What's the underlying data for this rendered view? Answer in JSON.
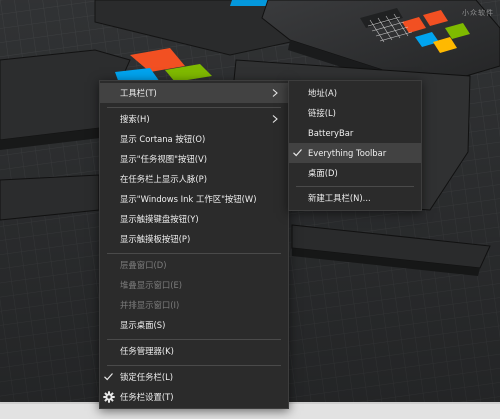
{
  "watermark": "小众软件",
  "main_menu": {
    "toolbars": "工具栏(T)",
    "search": "搜索(H)",
    "show_cortana": "显示 Cortana 按钮(O)",
    "show_task_view": "显示\"任务视图\"按钮(V)",
    "show_people": "在任务栏上显示人脉(P)",
    "show_ink": "显示\"Windows Ink 工作区\"按钮(W)",
    "show_touch_keyboard": "显示触摸键盘按钮(Y)",
    "show_touchpad": "显示触摸板按钮(P)",
    "cascade": "层叠窗口(D)",
    "stacked": "堆叠显示窗口(E)",
    "side_by_side": "并排显示窗口(I)",
    "show_desktop": "显示桌面(S)",
    "task_manager": "任务管理器(K)",
    "lock_taskbar": "锁定任务栏(L)",
    "taskbar_settings": "任务栏设置(T)"
  },
  "sub_menu": {
    "address": "地址(A)",
    "links": "链接(L)",
    "batterybar": "BatteryBar",
    "everything_toolbar": "Everything Toolbar",
    "desktop": "桌面(D)",
    "new_toolbar": "新建工具栏(N)..."
  },
  "colors": {
    "menu_bg": "#2b2b2b",
    "highlight": "#424242",
    "text": "#f0f0f0",
    "disabled_text": "#7c7c7c",
    "logo_red": "#f25022",
    "logo_green": "#7fba00",
    "logo_blue": "#00a4ef",
    "logo_yellow": "#ffb900"
  },
  "icons": {
    "submenu_arrow": "chevron-right-icon",
    "checked": "checkmark-icon",
    "settings": "gear-icon"
  }
}
